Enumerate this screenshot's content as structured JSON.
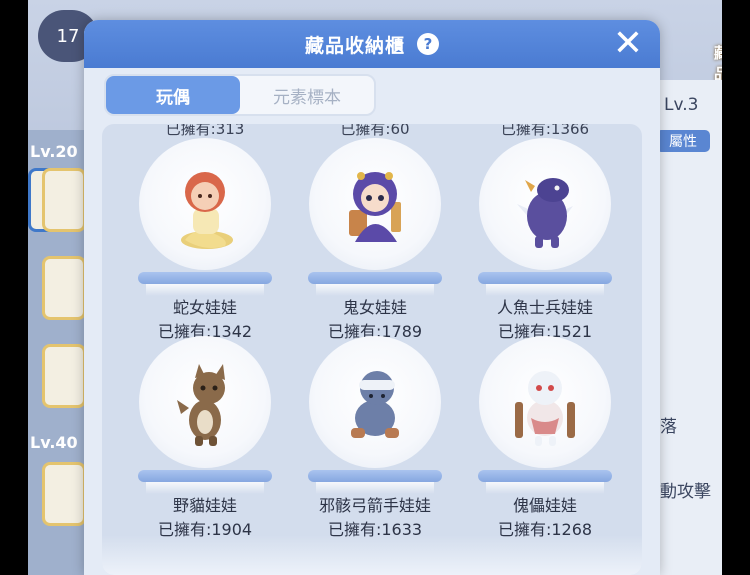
{
  "background": {
    "badge_value": "17",
    "level_labels": [
      "Lv.20",
      "Lv.40"
    ],
    "right_level": "Lv.3",
    "right_chip": "屬性",
    "right_texts": [
      "落",
      "動攻擊"
    ],
    "collection_button": "藏品"
  },
  "modal": {
    "title": "藏品收納櫃",
    "help_label": "?",
    "close_label": "✕",
    "tabs": [
      {
        "label": "玩偶",
        "active": true
      },
      {
        "label": "元素標本",
        "active": false
      }
    ],
    "cropped_counts": [
      "已擁有:313",
      "已擁有:60",
      "已擁有:1366"
    ],
    "items": [
      {
        "name": "蛇女娃娃",
        "count": "已擁有:1342",
        "icon": "snake-girl-doll-icon"
      },
      {
        "name": "鬼女娃娃",
        "count": "已擁有:1789",
        "icon": "ghost-girl-doll-icon"
      },
      {
        "name": "人魚士兵娃娃",
        "count": "已擁有:1521",
        "icon": "merfolk-soldier-doll-icon"
      },
      {
        "name": "野貓娃娃",
        "count": "已擁有:1904",
        "icon": "wildcat-doll-icon"
      },
      {
        "name": "邪骸弓箭手娃娃",
        "count": "已擁有:1633",
        "icon": "skeleton-archer-doll-icon"
      },
      {
        "name": "傀儡娃娃",
        "count": "已擁有:1268",
        "icon": "puppet-doll-icon"
      }
    ]
  },
  "colors": {
    "header_blue": "#4a7bd2",
    "tab_active": "#6b9ae6",
    "panel_bg": "#d3dded"
  }
}
